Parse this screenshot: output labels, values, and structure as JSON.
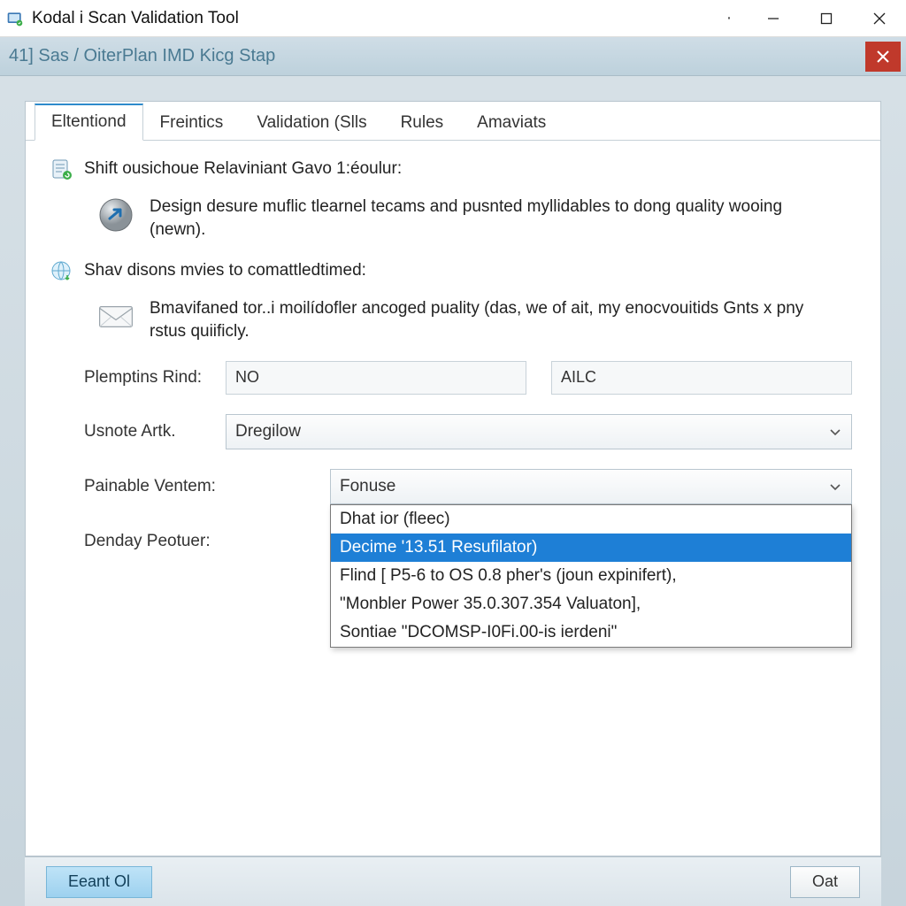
{
  "window": {
    "title": "Kodal i Scan Validation Tool"
  },
  "subheader": {
    "crumb": "41͏] Sas / OiterPlan IMD Kicg Stap"
  },
  "tabs": [
    {
      "label": "Eltentiond",
      "active": true
    },
    {
      "label": "Freintics",
      "active": false
    },
    {
      "label": "Validation (Slls",
      "active": false
    },
    {
      "label": "Rules",
      "active": false
    },
    {
      "label": "Amaviats",
      "active": false
    }
  ],
  "section1": {
    "heading": "Shift ousichoue Relaviniant Gavo 1:éoulur:",
    "description": "Design desure muflic tlearnel tecams and pusnted myllidables to dong quality wooing (newn)."
  },
  "section2": {
    "heading": "Shav disons mvies to comattledtimed:",
    "description": "Bmavifaned tor..i moilídofler ancoged puality (das, we of ait, my enocvouitids Gnts x pny rstus quiificly."
  },
  "form": {
    "row1": {
      "label": "Plemptins Rind:",
      "value1": "NO",
      "value2": "AILC"
    },
    "row2": {
      "label": "Usnote Artk.",
      "value": "Dregilow"
    },
    "row3": {
      "label": "Painable Ventem:",
      "value": "Fonuse"
    },
    "row4": {
      "label": "Denday Peotuer:"
    }
  },
  "dropdown": {
    "options": [
      "Dhat ior (fleec)",
      "Decime '13.51 Resufilator)",
      "Flind [ P5-6 to OS 0.8 pher's (joun expinifert),",
      "\"Monbler Power 35.0.307.354 Valuaton],",
      "Sontiae \"DCOMSP-I0Fi.00-is ierdeni\""
    ],
    "selected_index": 1
  },
  "buttons": {
    "primary": "Eeant Ol",
    "secondary": "Oat"
  }
}
